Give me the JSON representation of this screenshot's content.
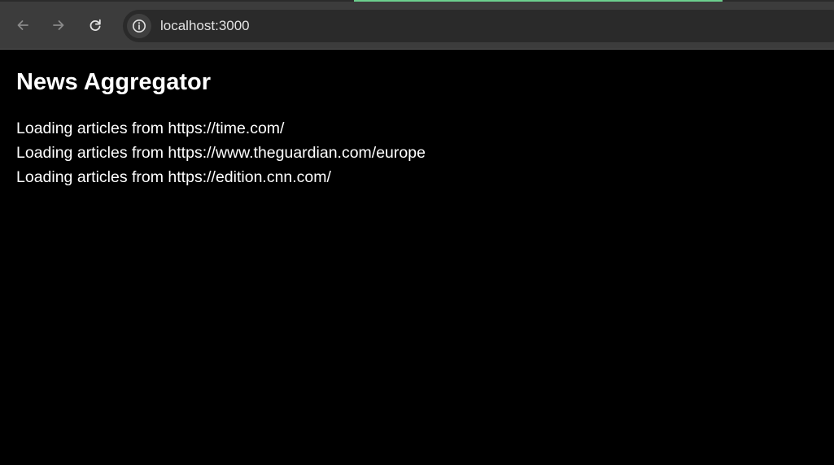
{
  "browser": {
    "url": "localhost:3000"
  },
  "icons": {
    "back": "arrow-left-icon",
    "forward": "arrow-right-icon",
    "reload": "reload-icon",
    "site_info": "info-icon"
  },
  "page": {
    "title": "News Aggregator",
    "status_lines": [
      "Loading articles from https://time.com/",
      "Loading articles from https://www.theguardian.com/europe",
      "Loading articles from https://edition.cnn.com/"
    ]
  },
  "colors": {
    "background": "#000000",
    "text": "#ffffff",
    "chrome": "#3c3c3c",
    "omnibox": "#2a2a2a",
    "progress": "#6ccf8e"
  }
}
